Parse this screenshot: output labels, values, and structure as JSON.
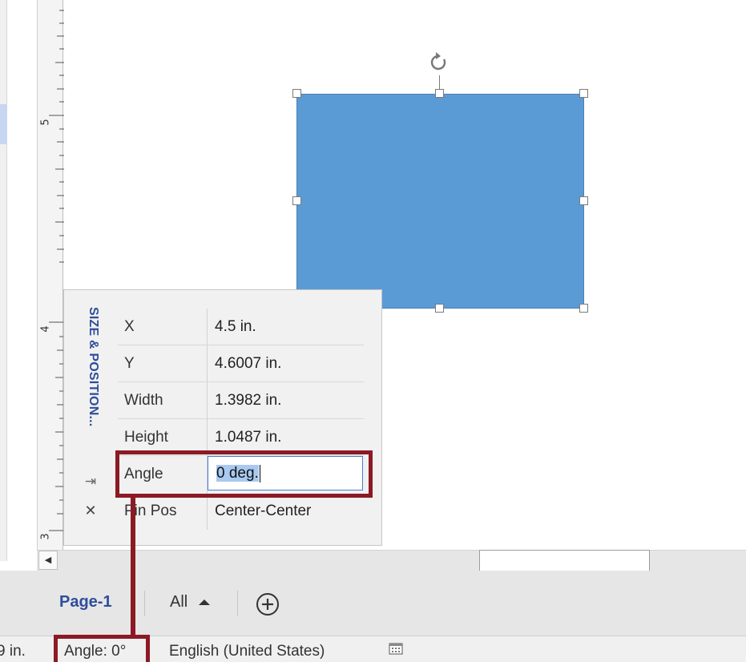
{
  "ruler": {
    "labels": [
      "5",
      "4",
      "3"
    ]
  },
  "size_position_panel": {
    "title": "SIZE & POSITION...",
    "rows": [
      {
        "label": "X",
        "value": "4.5 in."
      },
      {
        "label": "Y",
        "value": "4.6007 in."
      },
      {
        "label": "Width",
        "value": "1.3982 in."
      },
      {
        "label": "Height",
        "value": "1.0487 in."
      },
      {
        "label": "Angle",
        "value": "0 deg."
      },
      {
        "label": "Pin Pos",
        "value": "Center-Center"
      }
    ],
    "pin_icon": "pin-icon",
    "close_icon": "close-icon"
  },
  "page_tabs": {
    "active_tab": "Page-1",
    "all_label": "All",
    "add_icon": "plus-circle-icon"
  },
  "status_bar": {
    "position_fragment": "9 in.",
    "angle": "Angle: 0°",
    "language": "English (United States)",
    "macro_icon": "macro-record-icon"
  },
  "colors": {
    "shape_fill": "#5b9bd5",
    "panel_title": "#2e4d9c",
    "annotation": "#8b1a24",
    "selection": "#a9c9f0"
  }
}
